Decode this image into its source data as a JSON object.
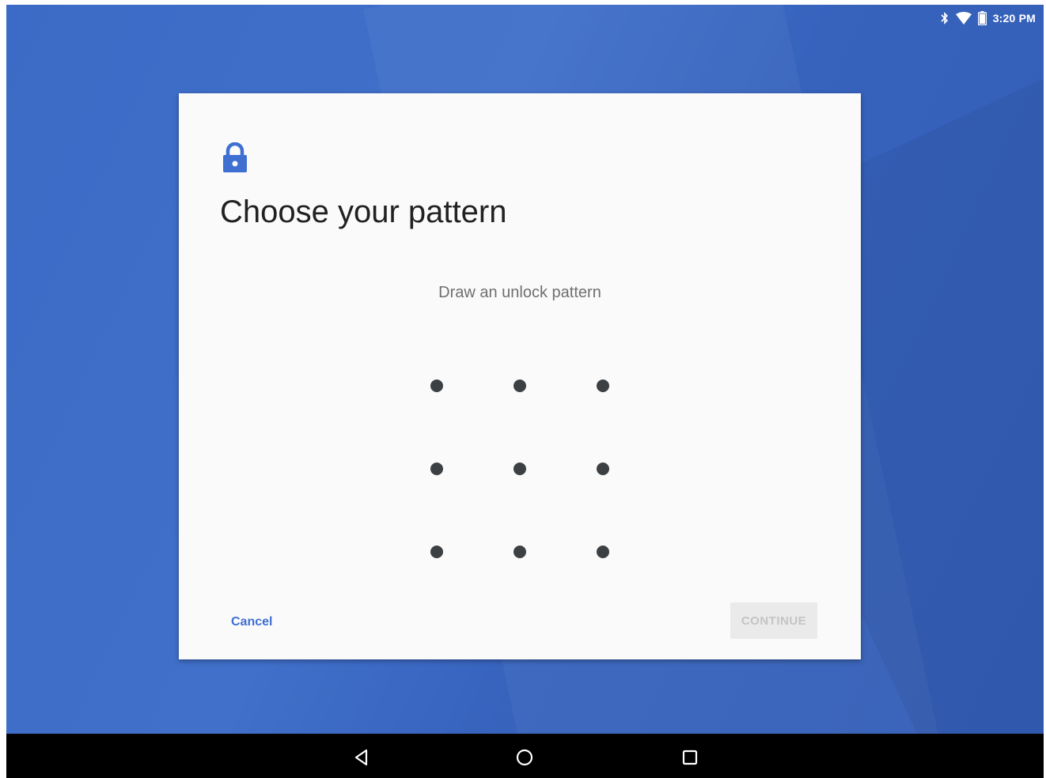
{
  "status_bar": {
    "time": "3:20 PM",
    "icons": [
      "bluetooth-icon",
      "wifi-icon",
      "battery-icon"
    ]
  },
  "dialog": {
    "icon": "lock-icon",
    "title": "Choose your pattern",
    "subtitle": "Draw an unlock pattern",
    "pattern_grid": {
      "rows": 3,
      "cols": 3
    },
    "cancel_label": "Cancel",
    "continue_label": "CONTINUE"
  },
  "nav_bar": {
    "icons": [
      "back-icon",
      "home-icon",
      "recents-icon"
    ]
  },
  "colors": {
    "background": "#3b6bc6",
    "accent": "#3f6fd1",
    "dialog_bg": "#fafafa",
    "dot": "#3c4043"
  }
}
